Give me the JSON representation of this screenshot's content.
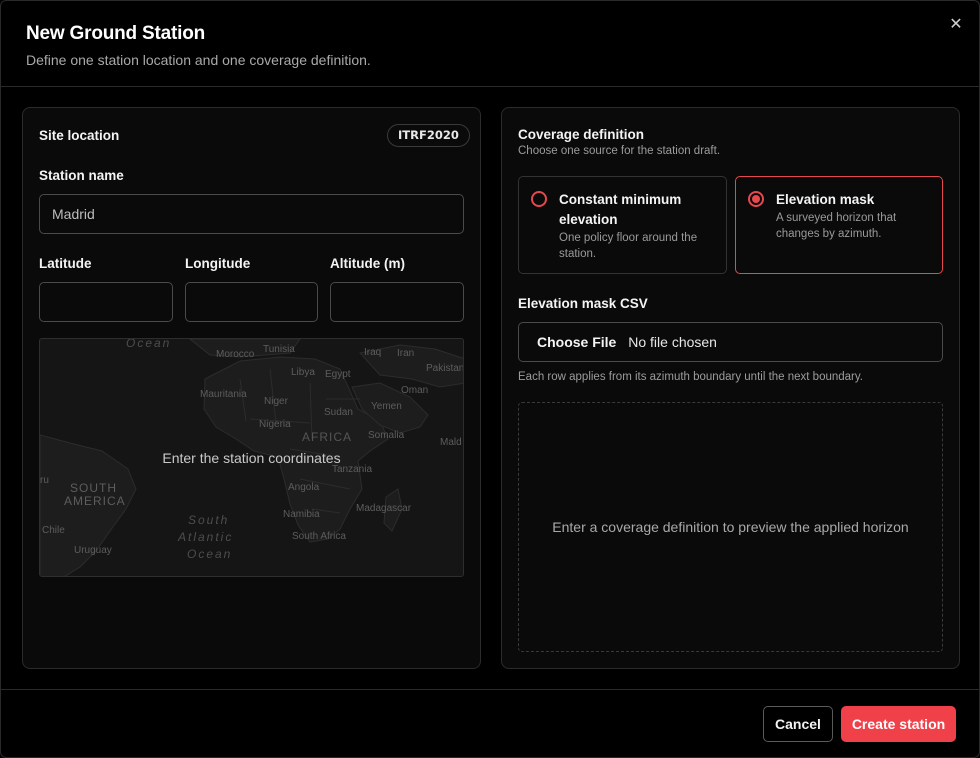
{
  "dialog": {
    "title": "New Ground Station",
    "subtitle": "Define one station location and one coverage definition.",
    "close_icon": "close-icon"
  },
  "site": {
    "heading": "Site location",
    "badge": "ITRF2020",
    "station_name_label": "Station name",
    "station_name_value": "Madrid",
    "latitude_label": "Latitude",
    "longitude_label": "Longitude",
    "altitude_label": "Altitude (m)",
    "latitude_value": "",
    "longitude_value": "",
    "altitude_value": "",
    "map_message": "Enter the station coordinates",
    "map_labels": {
      "ocean_top": "Ocean",
      "morocco": "Morocco",
      "tunisia": "Tunisia",
      "libya": "Libya",
      "egypt": "Egypt",
      "iraq": "Iraq",
      "iran": "Iran",
      "pakistan": "Pakistan",
      "oman": "Oman",
      "mauritania": "Mauritania",
      "niger": "Niger",
      "sudan": "Sudan",
      "yemen": "Yemen",
      "nigeria": "Nigeria",
      "africa": "AFRICA",
      "somalia": "Somalia",
      "maldives": "Mald",
      "tanzania": "Tanzania",
      "south_america_1": "SOUTH",
      "south_america_2": "AMERICA",
      "angola": "Angola",
      "namibia": "Namibia",
      "madagascar": "Madagascar",
      "chile": "Chile",
      "south_africa": "South Africa",
      "uruguay": "Uruguay",
      "south_atlantic_1": "South",
      "south_atlantic_2": "Atlantic",
      "south_atlantic_3": "Ocean",
      "peru_fragment": "ru"
    }
  },
  "coverage": {
    "heading": "Coverage definition",
    "subheading": "Choose one source for the station draft.",
    "options": [
      {
        "title": "Constant minimum elevation",
        "desc": "One policy floor around the station.",
        "selected": false
      },
      {
        "title": "Elevation mask",
        "desc": "A surveyed horizon that changes by azimuth.",
        "selected": true
      }
    ],
    "csv_label": "Elevation mask CSV",
    "file_button": "Choose File",
    "file_status": "No file chosen",
    "csv_hint": "Each row applies from its azimuth boundary until the next boundary.",
    "preview_message": "Enter a coverage definition to preview the applied horizon"
  },
  "footer": {
    "cancel": "Cancel",
    "create": "Create station"
  },
  "colors": {
    "accent": "#f0414b",
    "background": "#000000",
    "panel": "#0a0a0a"
  }
}
